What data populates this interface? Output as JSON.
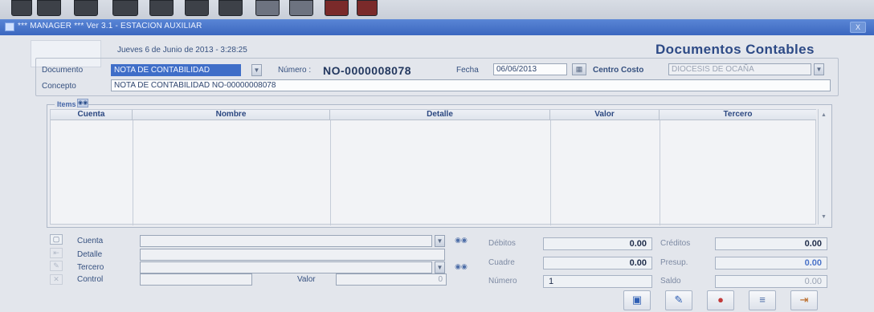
{
  "window": {
    "title": "*** MANAGER *** Ver 3.1 - ESTACION AUXILIAR",
    "close_label": "X"
  },
  "header": {
    "date_text": "Jueves 6 de Junio de 2013 - 3:28:25",
    "doc_title": "Documentos Contables"
  },
  "form": {
    "documento_label": "Documento",
    "documento_value": "NOTA DE CONTABILIDAD",
    "numero_label": "Número :",
    "numero_value": "NO-0000008078",
    "fecha_label": "Fecha",
    "fecha_value": "06/06/2013",
    "centro_costo_label": "Centro Costo",
    "centro_costo_value": "DIOCESIS DE OCAÑA",
    "concepto_label": "Concepto",
    "concepto_value": "NOTA DE CONTABILIDAD NO-00000008078"
  },
  "items": {
    "label": "Items",
    "columns": [
      "Cuenta",
      "Nombre",
      "Detalle",
      "Valor",
      "Tercero"
    ]
  },
  "entry": {
    "cuenta_label": "Cuenta",
    "detalle_label": "Detalle",
    "tercero_label": "Tercero",
    "control_label": "Control",
    "valor_label": "Valor",
    "valor_value": "0"
  },
  "totals": {
    "debitos_label": "Débitos",
    "debitos_value": "0.00",
    "creditos_label": "Créditos",
    "creditos_value": "0.00",
    "cuadre_label": "Cuadre",
    "cuadre_value": "0.00",
    "presup_label": "Presup.",
    "presup_value": "0.00",
    "numero_label": "Número",
    "numero_value": "1",
    "saldo_label": "Saldo",
    "saldo_value": "0.00"
  },
  "colors": {
    "title_bar": "#3b67bf",
    "selection": "#3f6ec8",
    "text": "#1f3f86"
  },
  "icons": [
    "save-icon",
    "edit-icon",
    "delete-icon",
    "print-icon",
    "exit-icon",
    "binoculars-icon",
    "calendar-icon"
  ]
}
